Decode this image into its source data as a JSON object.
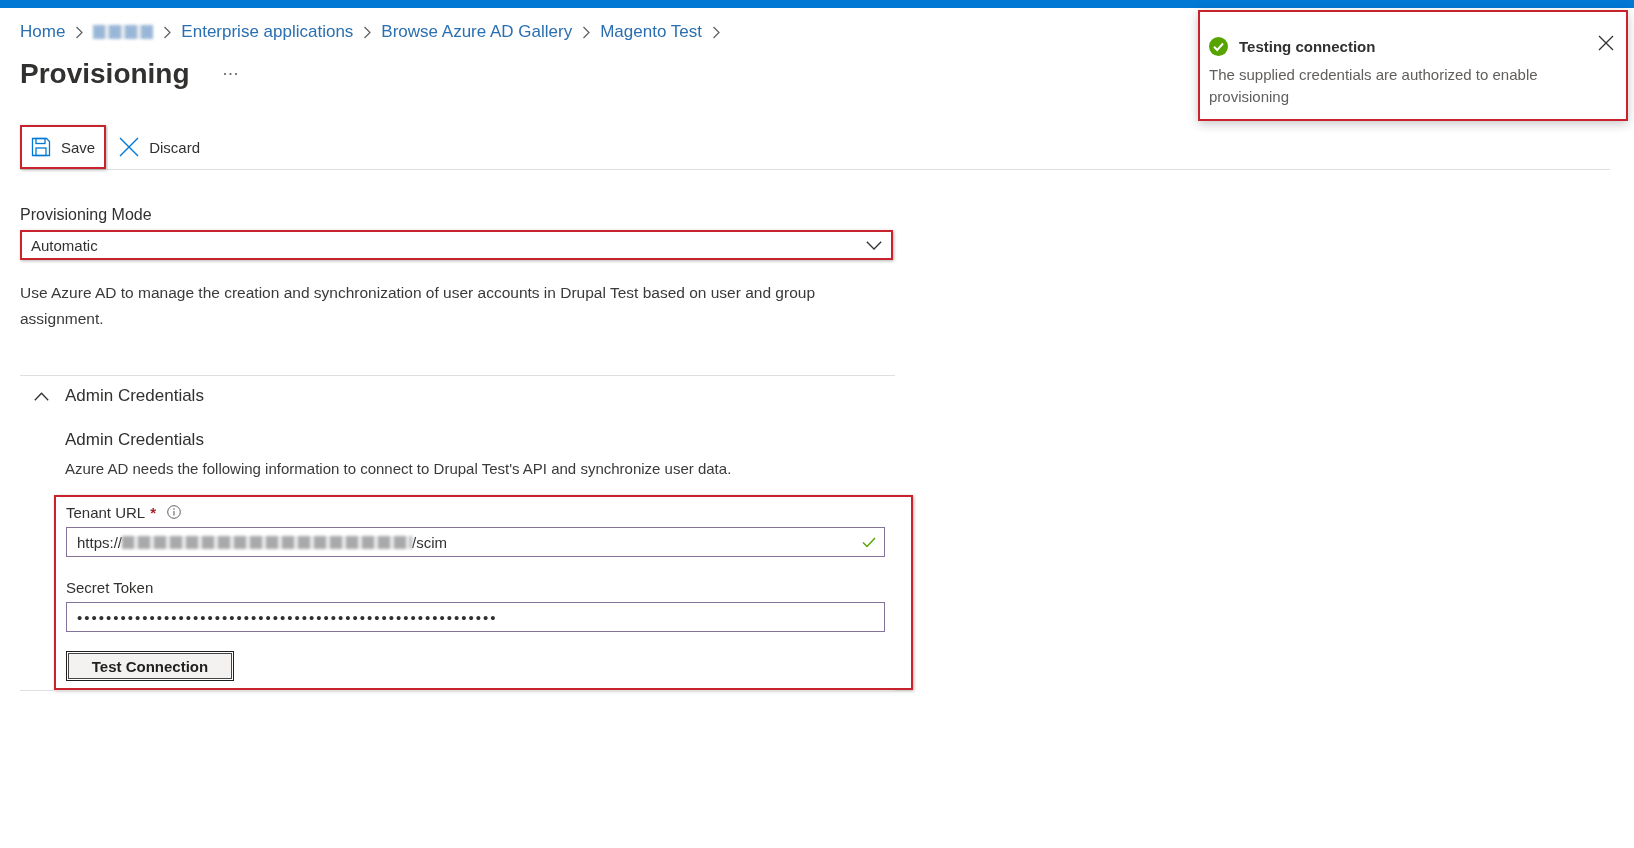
{
  "breadcrumb": [
    {
      "kind": "link",
      "label": "Home"
    },
    {
      "kind": "redacted"
    },
    {
      "kind": "link",
      "label": "Enterprise applications"
    },
    {
      "kind": "link",
      "label": "Browse Azure AD Gallery"
    },
    {
      "kind": "link",
      "label": "Magento Test"
    }
  ],
  "page_title": "Provisioning",
  "toolbar": [
    {
      "kind": "save",
      "label": "Save",
      "highlighted": true
    },
    {
      "kind": "discard",
      "label": "Discard",
      "highlighted": false
    }
  ],
  "provisioning_mode": {
    "label": "Provisioning Mode",
    "value": "Automatic",
    "highlighted": true
  },
  "description": "Use Azure AD to manage the creation and synchronization of user accounts in Drupal Test based on user and group assignment.",
  "admin_credentials": {
    "title": "Admin Credentials",
    "expanded": true,
    "heading": "Admin Credentials",
    "description": "Azure AD needs the following information to connect to Drupal Test's API and synchronize user data.",
    "highlighted": true,
    "fields": [
      {
        "kind": "url",
        "label": "Tenant URL",
        "required_mark": "*",
        "info": true,
        "value_start": "https://",
        "redacted": true,
        "value_end": "/scim",
        "valid": true
      },
      {
        "kind": "secret",
        "label": "Secret Token",
        "info": false,
        "value": "••••••••••••••••••••••••••••••••••••••••••••••••••••••••••",
        "valid": false
      }
    ],
    "button": "Test Connection"
  },
  "notification": {
    "success": true,
    "title": "Testing connection",
    "message": "The supplied credentials are authorized to enable provisioning",
    "highlighted": true
  }
}
